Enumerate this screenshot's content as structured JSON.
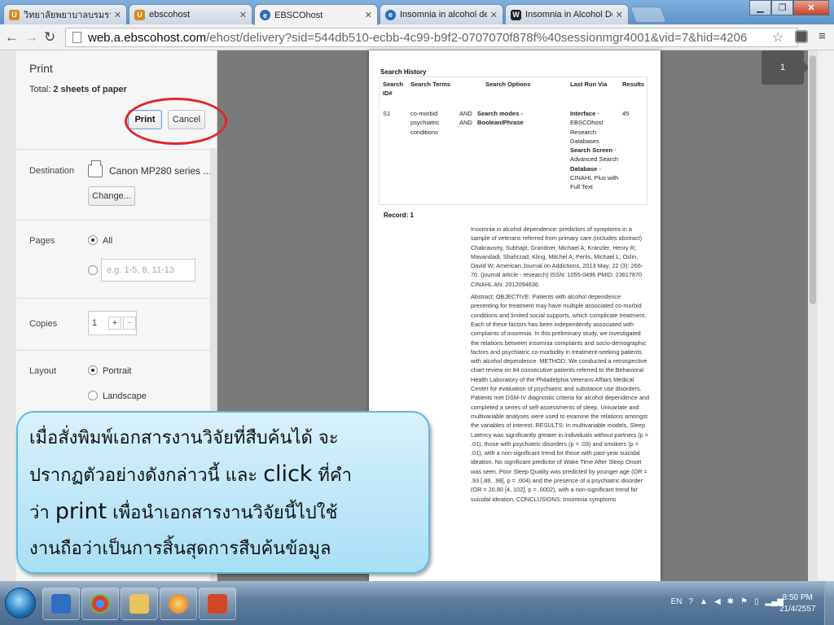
{
  "browser": {
    "tabs": [
      {
        "title": "วิทยาลัยพยาบาลบรมราชชนนี",
        "fav": "U",
        "fav_color": "#d98a1c"
      },
      {
        "title": "ebscohost",
        "fav": "U",
        "fav_color": "#d98a1c"
      },
      {
        "title": "EBSCOhost",
        "fav": "e",
        "fav_color": "#2a6db5"
      },
      {
        "title": "Insomnia in alcohol depen",
        "fav": "e",
        "fav_color": "#2a6db5"
      },
      {
        "title": "Insomnia in Alcohol Depe",
        "fav": "W",
        "fav_color": "#222222"
      }
    ],
    "url_host": "web.a.ebscohost.com",
    "url_path": "/ehost/delivery?sid=544db510-ecbb-4c99-b9f2-0707070f878f%40sessionmgr4001&vid=7&hid=4206"
  },
  "print_panel": {
    "title": "Print",
    "total_prefix": "Total: ",
    "total_value": "2 sheets of paper",
    "print_label": "Print",
    "cancel_label": "Cancel",
    "destination_label": "Destination",
    "destination_value": "Canon MP280 series ...",
    "change_label": "Change...",
    "pages_label": "Pages",
    "pages_all": "All",
    "pages_placeholder": "e.g. 1-5, 8, 11-13",
    "copies_label": "Copies",
    "copies_value": "1",
    "plus": "+",
    "minus": "−",
    "layout_label": "Layout",
    "portrait": "Portrait",
    "landscape": "Landscape"
  },
  "preview": {
    "search_history": "Search History",
    "headers": [
      "Search ID#",
      "Search Terms",
      "Search Options",
      "Last Run Via",
      "Results"
    ],
    "row": {
      "id": "S1",
      "terms": "co-morbid psychiatric conditions",
      "and": "AND AND",
      "options": "Search modes - Boolean/Phrase",
      "interface_label": "Interface",
      "interface_value": "- EBSCOhost Research Databases",
      "screen_label": "Search Screen",
      "screen_value": "- Advanced Search",
      "db_label": "Database",
      "db_value": "- CINAHL Plus with Full Text",
      "results": "45"
    },
    "record_label": "Record: 1",
    "citation": "Insomnia in alcohol dependence: predictors of symptoms in a sample of veterans referred from primary care.(includes abstract) Chakravorty, Subhajit; Grandner, Michael A; Kranzler, Henry R; Mavandadi, Shahrzad; Kling, Mitchel A; Perlis, Michael L; Oslin, David W; American Journal on Addictions, 2013 May; 22 (3): 266-70. (journal article - research) ISSN: 1055-0496 PMID: 23617870 CINAHL AN: 2012094636",
    "abstract": "Abstract: OBJECTIVE: Patients with alcohol dependence presenting for treatment may have multiple associated co-morbid conditions and limited social supports, which complicate treatment. Each of these factors has been independently associated with complaints of insomnia. In this preliminary study, we investigated the relations between insomnia complaints and socio-demographic factors and psychiatric co-morbidity in treatment-seeking patients with alcohol dependence. METHOD: We conducted a retrospective chart review on 84 consecutive patients referred to the Behavioral Health Laboratory of the Philadelphia Veterans Affairs Medical Center for evaluation of psychiatric and substance use disorders. Patients met DSM-IV diagnostic criteria for alcohol dependence and completed a series of self-assessments of sleep. Univariate and multivariable analyses were used to examine the relations amongst the variables of interest. RESULTS: In multivariable models, Sleep Latency was significantly greater in individuals without partners (p = .01), those with psychiatric disorders (p = .03) and smokers (p = .01), with a non-significant trend for those with past-year suicidal ideation. No significant predictor of Wake Time After Sleep Onset was seen. Poor Sleep Quality was predicted by younger age (OR = .93 [.88, .98], p = .004) and the presence of a psychiatric disorder (OR = 20.80 [4, 102], p = .0002), with a non-significant trend for suicidal ideation. CONCLUSIONS: Insomnia symptoms",
    "page_number": "1"
  },
  "callout": {
    "line1": "เมื่อสั่งพิมพ์เอกสารงานวิจัยที่สืบค้นได้ จะ",
    "line2a": "ปรากฏตัวอย่างดังกล่าวนี้ และ ",
    "line2b": "click",
    "line2c": " ที่คำ",
    "line3a": "ว่า ",
    "line3b": "print",
    "line3c": " เพื่อนำเอกสารงานวิจัยนี้ไปใช้",
    "line4": "งานถือว่าเป็นการสิ้นสุดการสืบค้นข้อมูล"
  },
  "taskbar": {
    "lang": "EN",
    "time": "8:50 PM",
    "date": "21/4/2557"
  },
  "colors": {
    "highlight_ring": "#e0262b",
    "callout_fill": "#a9dff5"
  }
}
